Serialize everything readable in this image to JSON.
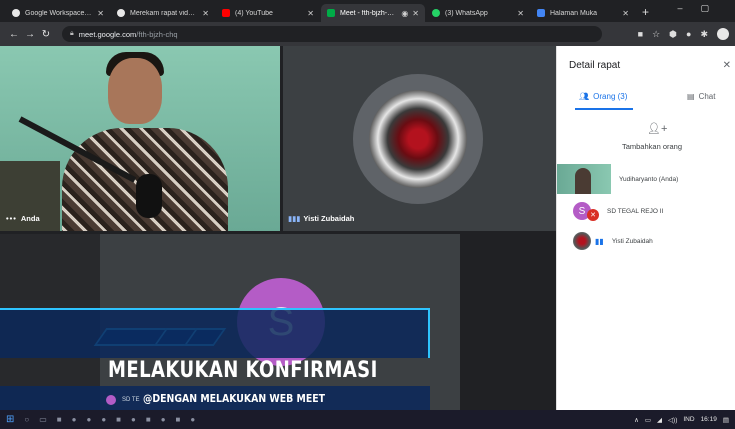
{
  "browser": {
    "tabs": [
      {
        "label": "Google Workspace [loc",
        "fav_color": "#e8e8e8",
        "active": false
      },
      {
        "label": "Merekam rapat video -",
        "fav_color": "#e8e8e8",
        "active": false
      },
      {
        "label": "(4) YouTube",
        "fav_color": "#ff0000",
        "active": false
      },
      {
        "label": "Meet - fth-bjzh-chq",
        "fav_color": "#00ac47",
        "active": true
      },
      {
        "label": "(3) WhatsApp",
        "fav_color": "#25d366",
        "active": false
      },
      {
        "label": "Halaman Muka",
        "fav_color": "#4285f4",
        "active": false
      }
    ],
    "url_host": "meet.google.com",
    "url_path": "/fth-bjzh-chq"
  },
  "meet": {
    "tile1_label": "Anda",
    "tile2_label": "Yisti Zubaidah",
    "tile3_avatar_letter": "S"
  },
  "overlay": {
    "title": "MELAKUKAN KONFIRMASI",
    "subtitle": "@DENGAN MELAKUKAN WEB MEET",
    "small_name": "SD TE"
  },
  "panel": {
    "title": "Detail rapat",
    "tab_people": "Orang (3)",
    "tab_chat": "Chat",
    "add_people": "Tambahkan orang",
    "participants": [
      {
        "name": "Yudiharyanto (Anda)"
      },
      {
        "name": "SD TEGAL REJO II",
        "avatar_letter": "S"
      },
      {
        "name": "Yisti Zubaidah"
      }
    ]
  },
  "taskbar": {
    "lang": "IND",
    "time": "16:19"
  },
  "colors": {
    "accent": "#1a73e8",
    "avatar_purple": "#b45cc6",
    "overlay_blue": "#2ec4ff"
  }
}
